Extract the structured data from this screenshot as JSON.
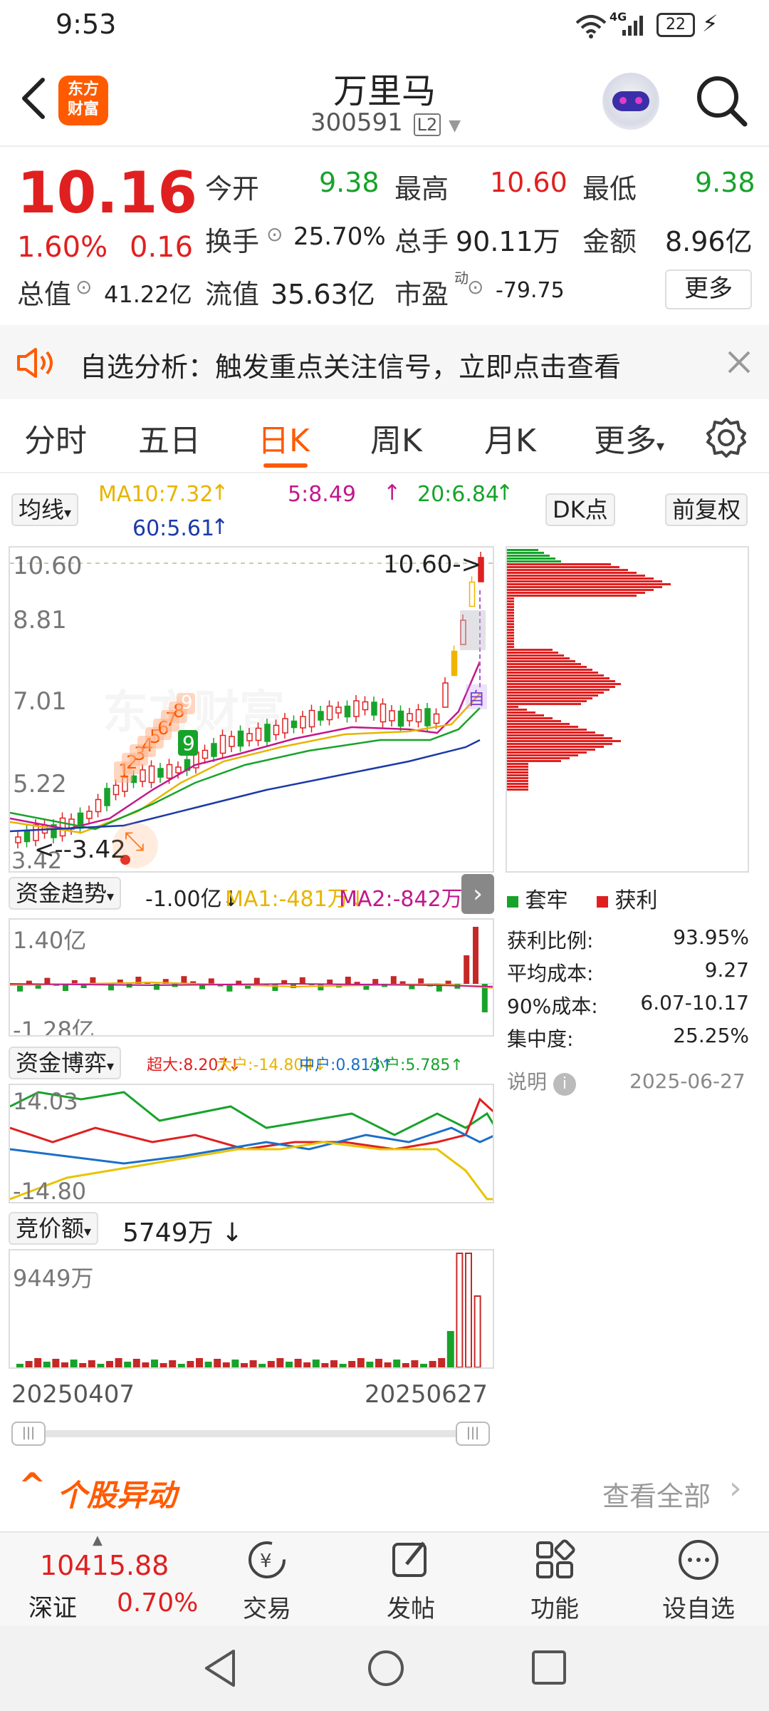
{
  "status_bar": {
    "time": "9:53",
    "network": "4G",
    "battery": "22"
  },
  "header": {
    "brand_logo": "东方\n财富",
    "stock_name": "万里马",
    "stock_code": "300591",
    "level_badge": "L2"
  },
  "quote": {
    "price": "10.16",
    "change_pct": "1.60%",
    "change": "0.16",
    "open_label": "今开",
    "open": "9.38",
    "high_label": "最高",
    "high": "10.60",
    "low_label": "最低",
    "low": "9.38",
    "turnover_label": "换手",
    "turnover": "25.70%",
    "volume_label": "总手",
    "volume": "90.11万",
    "amount_label": "金额",
    "amount": "8.96亿",
    "mcap_label": "总值",
    "mcap": "41.22亿",
    "float_label": "流值",
    "float": "35.63亿",
    "pe_label": "市盈",
    "pe_sup": "动",
    "pe": "-79.75",
    "more_button": "更多"
  },
  "alert": {
    "text": "自选分析：触发重点关注信号，立即点击查看"
  },
  "tabs": [
    "分时",
    "五日",
    "日K",
    "周K",
    "月K",
    "更多"
  ],
  "active_tab": 2,
  "ma": {
    "selector": "均线",
    "ma10": "MA10:7.32",
    "ma5": "5:8.49",
    "ma20": "20:6.84",
    "ma60": "60:5.61",
    "dk_button": "DK点",
    "adjust_button": "前复权"
  },
  "kline": {
    "y_labels": [
      "10.60",
      "8.81",
      "7.01",
      "5.22",
      "3.42"
    ],
    "high_marker": "10.60->",
    "low_marker": "<--3.42",
    "watermark": "东方财富",
    "signals": [
      "1",
      "2",
      "3",
      "4",
      "5",
      "6",
      "7",
      "8",
      "9"
    ],
    "self_tag": "自",
    "low_price_label": "3.42"
  },
  "chip": {
    "legend_trapped": "套牢",
    "legend_profit": "获利",
    "rows": [
      {
        "label": "获利比例:",
        "value": "93.95%"
      },
      {
        "label": "平均成本:",
        "value": "9.27"
      },
      {
        "label": "90%成本:",
        "value": "6.07-10.17"
      },
      {
        "label": "集中度:",
        "value": "25.25%"
      }
    ],
    "note_label": "说明",
    "date": "2025-06-27"
  },
  "fund_trend": {
    "title": "资金趋势",
    "value": "-1.00亿↓",
    "ma1": "MA1:-481万↓",
    "ma2": "MA2:-842万↓",
    "top": "1.40亿",
    "bottom": "-1.28亿"
  },
  "fund_game": {
    "title": "资金博弈",
    "super": "超大:8.207↓",
    "large": "大户:-14.804↓",
    "mid": "中户:0.813↑",
    "small": "小户:5.785↑",
    "top": "14.03",
    "bottom": "-14.80"
  },
  "auction": {
    "title": "竞价额",
    "value": "5749万 ↓",
    "top": "9449万"
  },
  "date_range": {
    "start": "20250407",
    "end": "20250627"
  },
  "stock_moves": {
    "title": "个股异动",
    "link": "查看全部"
  },
  "bottom_nav": {
    "index_value": "10415.88",
    "index_name": "深证",
    "index_change": "0.70%",
    "items": [
      "交易",
      "发帖",
      "功能",
      "设自选"
    ]
  },
  "colors": {
    "accent": "#ff5a00",
    "up": "#e02020",
    "down": "#17a32a",
    "ma5": "#c2188c",
    "ma10": "#e8b400",
    "ma20": "#17a32a",
    "ma60": "#1b3aa8"
  }
}
